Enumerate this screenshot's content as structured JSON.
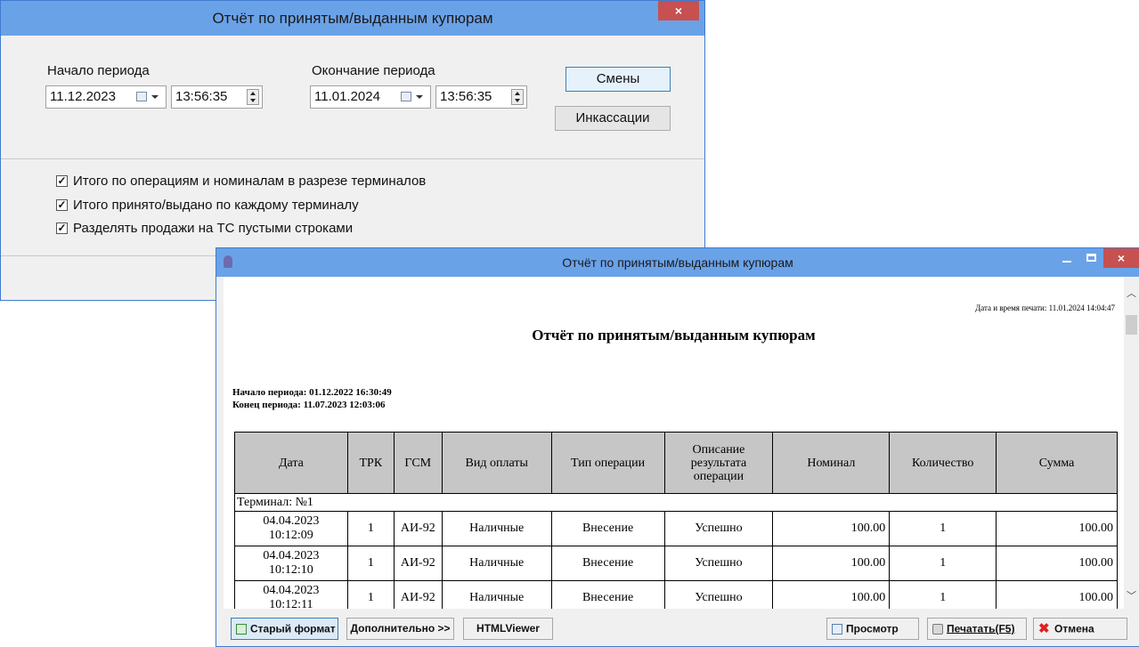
{
  "dialog": {
    "title": "Отчёт по принятым/выданным купюрам",
    "close_glyph": "×",
    "period_start": {
      "label": "Начало периода",
      "date": "11.12.2023",
      "time": "13:56:35"
    },
    "period_end": {
      "label": "Окончание периода",
      "date": "11.01.2024",
      "time": "13:56:35"
    },
    "buttons": {
      "shifts": "Смены",
      "collections": "Инкассации"
    },
    "checkboxes": [
      {
        "label": "Итого по операциям и номиналам в разрезе терминалов",
        "checked": true
      },
      {
        "label": "Итого принято/выдано по каждому терминалу",
        "checked": true
      },
      {
        "label": "Разделять продажи на ТС пустыми строками",
        "checked": true
      }
    ]
  },
  "viewer": {
    "title": "Отчёт по принятым/выданным купюрам",
    "close_glyph": "×",
    "report": {
      "print_stamp": "Дата и время печати: 11.01.2024 14:04:47",
      "title": "Отчёт по принятым/выданным купюрам",
      "period_start": "Начало периода: 01.12.2022 16:30:49",
      "period_end": "Конец периода: 11.07.2023 12:03:06",
      "columns": [
        "Дата",
        "ТРК",
        "ГСМ",
        "Вид оплаты",
        "Тип операции",
        "Описание результата операции",
        "Номинал",
        "Количество",
        "Сумма"
      ],
      "group_label": "Терминал: №1",
      "rows": [
        {
          "date": "04.04.2023",
          "time": "10:12:09",
          "trk": "1",
          "fuel": "АИ-92",
          "payment": "Наличные",
          "op_type": "Внесение",
          "result": "Успешно",
          "nominal": "100.00",
          "qty": "1",
          "sum": "100.00"
        },
        {
          "date": "04.04.2023",
          "time": "10:12:10",
          "trk": "1",
          "fuel": "АИ-92",
          "payment": "Наличные",
          "op_type": "Внесение",
          "result": "Успешно",
          "nominal": "100.00",
          "qty": "1",
          "sum": "100.00"
        },
        {
          "date": "04.04.2023",
          "time": "10:12:11",
          "trk": "1",
          "fuel": "АИ-92",
          "payment": "Наличные",
          "op_type": "Внесение",
          "result": "Успешно",
          "nominal": "100.00",
          "qty": "1",
          "sum": "100.00"
        }
      ]
    },
    "toolbar": {
      "old_format": "Старый формат",
      "additional": "Дополнительно >>",
      "htmlviewer": "HTMLViewer",
      "preview": "Просмотр",
      "print": "Печатать(F5)",
      "cancel": "Отмена"
    }
  }
}
